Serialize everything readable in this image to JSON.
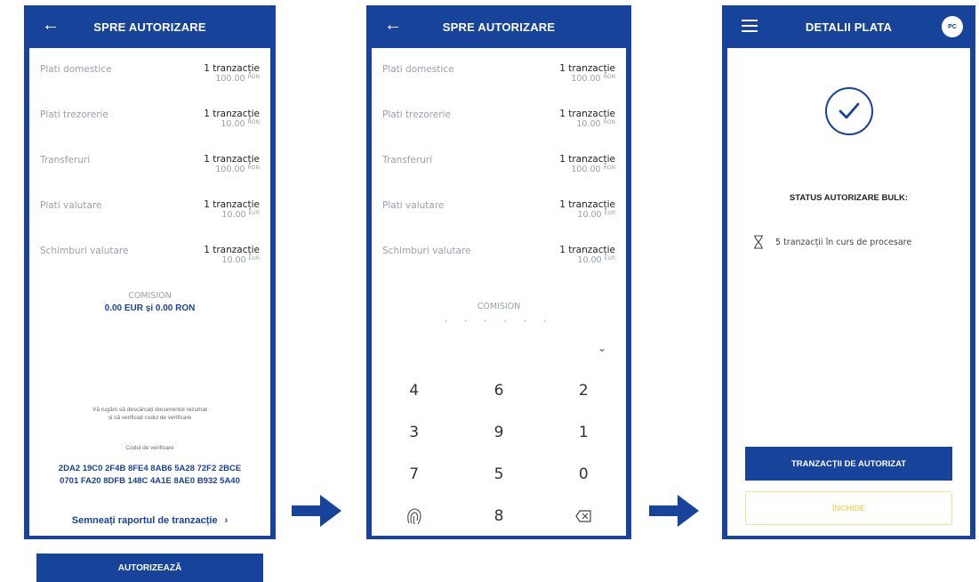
{
  "screen1": {
    "title": "SPRE AUTORIZARE",
    "rows": [
      {
        "label": "Plati domestice",
        "count": "1 tranzacție",
        "amount": "100.00",
        "currency": "RON"
      },
      {
        "label": "Plati trezorerie",
        "count": "1 tranzacție",
        "amount": "10.00",
        "currency": "RON"
      },
      {
        "label": "Transferuri",
        "count": "1 tranzacție",
        "amount": "100.00",
        "currency": "RON"
      },
      {
        "label": "Plati valutare",
        "count": "1 tranzacție",
        "amount": "10.00",
        "currency": "EUR"
      },
      {
        "label": "Schimburi valutare",
        "count": "1 tranzacție",
        "amount": "10.00",
        "currency": "EUR"
      }
    ],
    "comision_label": "COMISION",
    "comision_value": "0.00 EUR și 0.00 RON",
    "note_line1": "Vă rugăm să descărcați documentul rezumat",
    "note_line2": "și să verificați codul de verificare",
    "code_label": "Codul de verificare",
    "code_line1": "2DA2 19C0 2F4B 8FE4 8AB6 5A28 72F2 2BCE",
    "code_line2": "0701 FA20 8DFB 148C 4A1E 8AE0 B932 5A40",
    "sign_label": "Semneați raportul de tranzacție",
    "authorize_button": "AUTORIZEAZĂ"
  },
  "screen2": {
    "title": "SPRE AUTORIZARE",
    "rows": [
      {
        "label": "Plati domestice",
        "count": "1 tranzacție",
        "amount": "100.00",
        "currency": "RON"
      },
      {
        "label": "Plati trezorerie",
        "count": "1 tranzacție",
        "amount": "10.00",
        "currency": "RON"
      },
      {
        "label": "Transferuri",
        "count": "1 tranzacție",
        "amount": "100.00",
        "currency": "RON"
      },
      {
        "label": "Plati valutare",
        "count": "1 tranzacție",
        "amount": "10.00",
        "currency": "EUR"
      },
      {
        "label": "Schimburi valutare",
        "count": "1 tranzacție",
        "amount": "10.00",
        "currency": "EUR"
      }
    ],
    "comision_label": "COMISION",
    "pin_dots": "• • • • • •",
    "keys": [
      [
        "4",
        "6",
        "2"
      ],
      [
        "3",
        "9",
        "1"
      ],
      [
        "7",
        "5",
        "0"
      ]
    ],
    "bottom_middle_key": "8"
  },
  "screen3": {
    "title": "DETALII PLATA",
    "avatar": "PC",
    "status_title": "STATUS AUTORIZARE BULK:",
    "status_text": "5 tranzacții în curs de procesare",
    "primary_button": "TRANZACȚII DE AUTORIZAT",
    "close_button": "ÎNCHIDE"
  },
  "colors": {
    "brand": "#17439a",
    "muted": "#9aa0aa",
    "close_text": "#e6dc75"
  },
  "icons": {
    "back": "arrow-left-icon",
    "menu": "hamburger-icon",
    "check": "check-circle-icon",
    "hourglass": "hourglass-icon",
    "fingerprint": "fingerprint-icon",
    "backspace": "backspace-icon",
    "flow": "arrow-right-icon"
  }
}
